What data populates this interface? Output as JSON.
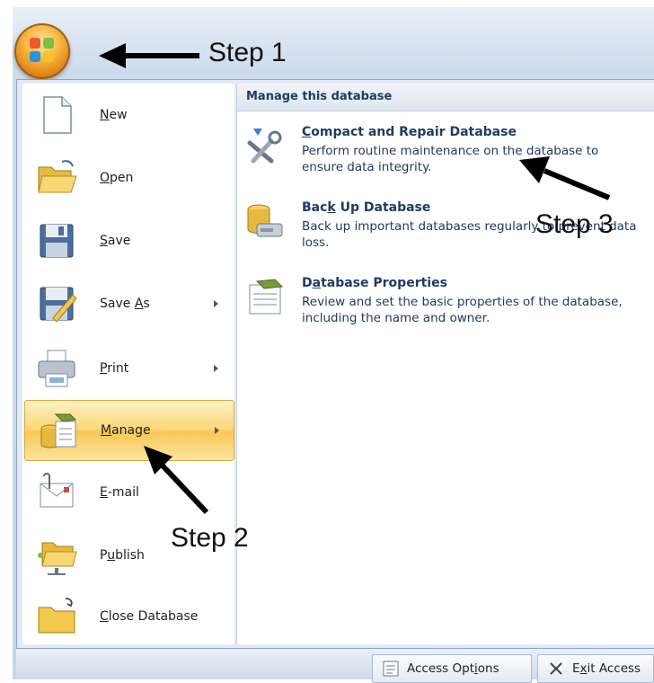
{
  "office_button": {
    "icon": "office-logo-icon"
  },
  "menu": {
    "items": [
      {
        "pre": "",
        "acc": "N",
        "post": "ew",
        "icon": "new-document-icon",
        "submenu": false
      },
      {
        "pre": "",
        "acc": "O",
        "post": "pen",
        "icon": "open-folder-icon",
        "submenu": false
      },
      {
        "pre": "",
        "acc": "S",
        "post": "ave",
        "icon": "save-disk-icon",
        "submenu": false
      },
      {
        "pre": "Save ",
        "acc": "A",
        "post": "s",
        "icon": "save-as-icon",
        "submenu": true
      },
      {
        "pre": "",
        "acc": "P",
        "post": "rint",
        "icon": "printer-icon",
        "submenu": true
      },
      {
        "pre": "",
        "acc": "M",
        "post": "anage",
        "icon": "manage-database-icon",
        "submenu": true,
        "selected": true
      },
      {
        "pre": "",
        "acc": "E",
        "post": "-mail",
        "icon": "email-icon",
        "submenu": false
      },
      {
        "pre": "P",
        "acc": "u",
        "post": "blish",
        "icon": "publish-icon",
        "submenu": false
      },
      {
        "pre": "",
        "acc": "C",
        "post": "lose Database",
        "icon": "close-database-icon",
        "submenu": false
      }
    ]
  },
  "submenu": {
    "header": "Manage this database",
    "items": [
      {
        "t_pre": "",
        "t_acc": "C",
        "t_post": "ompact and Repair Database",
        "desc": "Perform routine maintenance on the database to ensure data integrity.",
        "icon": "compact-repair-icon"
      },
      {
        "t_pre": "Bac",
        "t_acc": "k",
        "t_post": " Up Database",
        "desc": "Back up important databases regularly to prevent data loss.",
        "icon": "backup-database-icon"
      },
      {
        "t_pre": "D",
        "t_acc": "a",
        "t_post": "tabase Properties",
        "desc": "Review and set the basic properties of the database, including the name and owner.",
        "icon": "database-properties-icon"
      }
    ]
  },
  "bottom": {
    "options": {
      "pre": "Access Opt",
      "acc": "i",
      "post": "ons",
      "icon": "access-options-icon"
    },
    "exit": {
      "pre": "E",
      "acc": "x",
      "post": "it Access",
      "icon": "exit-x-icon"
    }
  },
  "annotations": {
    "step1": "Step 1",
    "step2": "Step 2",
    "step3": "Step 3"
  }
}
